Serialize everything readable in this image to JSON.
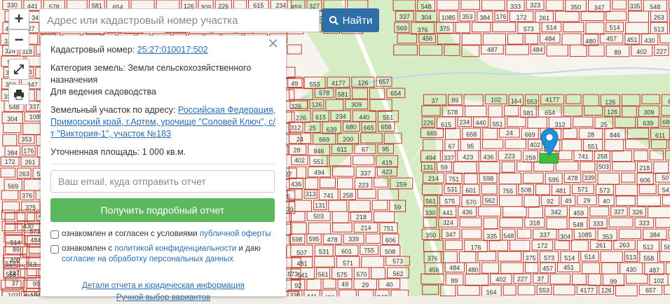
{
  "search": {
    "placeholder": "Адрес или кадастровый номер участка",
    "button_label": "Найти",
    "button_icon": "search-icon"
  },
  "map_controls": {
    "zoom_in": "+",
    "zoom_out": "−",
    "fullscreen_icon": "expand-icon",
    "print_icon": "printer-icon"
  },
  "parcel": {
    "cadastral_label": "Кадастровый номер:",
    "cadastral_number": "25:27:010017:502",
    "category_label": "Категория земель:",
    "category_value": "Земли сельскохозяйственного назначения",
    "usage": "Для ведения садоводства",
    "address_label": "Земельный участок по адресу:",
    "address_value": "Российская Федерация, Приморский край, г.Артем, урочище \"Соловей Ключ\", с/т \"Виктория-1\", участок №183",
    "area_label": "Уточненная площадь:",
    "area_value": "1 000 кв.м."
  },
  "order": {
    "email_placeholder": "Ваш email, куда отправить отчет",
    "button_label": "Получить подробный отчет",
    "agree1_text": "ознакомлен и согласен с условиями",
    "agree1_link": "публичной оферты",
    "agree2_text": "ознакомлен с",
    "agree2_link": "политикой конфиденциальности",
    "agree2_text2": "и даю",
    "agree2_link2": "согласие на обработку персональных данных",
    "details_link": "Детали отчета и юридическая информация",
    "manual_link": "Ручной выбор вариантов"
  },
  "map_labels": [
    "330",
    "441",
    "436",
    "342",
    "459",
    "327",
    "326",
    "324",
    "318",
    "548",
    "333",
    "323",
    "350",
    "347",
    "335",
    "548",
    "337",
    "304",
    "1085",
    "353",
    "384",
    "176",
    "172",
    "261",
    "263",
    "512",
    "569",
    "376",
    "375",
    "573",
    "514",
    "514",
    "513",
    "558",
    "456",
    "484",
    "480",
    "457",
    "451",
    "430",
    "487",
    "484",
    "89",
    "402",
    "227",
    "37",
    "99",
    "102",
    "164",
    "553",
    "4177",
    "126",
    "657",
    "578",
    "581",
    "654",
    "126",
    "309",
    "226",
    "615",
    "234",
    "440",
    "551",
    "312",
    "25",
    "639",
    "680",
    "665",
    "658",
    "24",
    "669",
    "200",
    "28",
    "846",
    "611",
    "67",
    "95",
    "402",
    "551",
    "419",
    "494",
    "337",
    "423",
    "436",
    "223",
    "259",
    "313",
    "741",
    "258",
    "131",
    "59",
    "503",
    "218",
    "214",
    "751",
    "598",
    "595",
    "478",
    "339",
    "606",
    "507",
    "531",
    "601",
    "755",
    "508",
    "481",
    "571",
    "573",
    "541",
    "561",
    "575",
    "570",
    "562",
    "92",
    "49",
    "29",
    "40"
  ],
  "colors": {
    "parcel_border": "#c0392b",
    "green_area": "#d6ecc4",
    "road": "#ffffff",
    "search_button": "#2f6fa8",
    "report_button": "#5cb85c",
    "link": "#2a6db0",
    "marker": "#1f8fd6",
    "selected_parcel": "#3cbf3c"
  }
}
